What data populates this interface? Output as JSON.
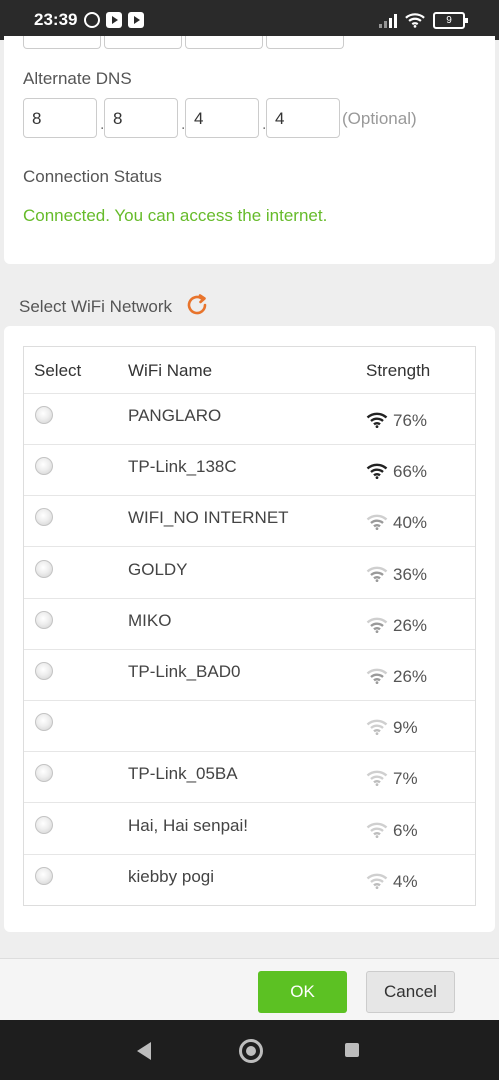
{
  "status_bar": {
    "time": "23:39",
    "battery": "9"
  },
  "dns": {
    "alternate_label": "Alternate DNS",
    "octets": [
      "8",
      "8",
      "4",
      "4"
    ],
    "optional": "(Optional)"
  },
  "connection": {
    "label": "Connection Status",
    "status": "Connected. You can access the internet.",
    "status_color": "#66bb2a"
  },
  "wifi": {
    "section_title": "Select WiFi Network",
    "headers": {
      "select": "Select",
      "name": "WiFi Name",
      "strength": "Strength"
    },
    "networks": [
      {
        "name": "PANGLARO",
        "strength": "76%",
        "level": 0.76
      },
      {
        "name": "TP-Link_138C",
        "strength": "66%",
        "level": 0.66
      },
      {
        "name": "WIFI_NO INTERNET",
        "strength": "40%",
        "level": 0.4
      },
      {
        "name": "GOLDY",
        "strength": "36%",
        "level": 0.36
      },
      {
        "name": "MIKO",
        "strength": "26%",
        "level": 0.26
      },
      {
        "name": "TP-Link_BAD0",
        "strength": "26%",
        "level": 0.26
      },
      {
        "name": "",
        "strength": "9%",
        "level": 0.09
      },
      {
        "name": "TP-Link_05BA",
        "strength": "7%",
        "level": 0.07
      },
      {
        "name": "Hai, Hai senpai!",
        "strength": "6%",
        "level": 0.06
      },
      {
        "name": "kiebby pogi",
        "strength": "4%",
        "level": 0.04
      }
    ]
  },
  "buttons": {
    "ok": "OK",
    "cancel": "Cancel",
    "ok_color": "#5cc123"
  }
}
